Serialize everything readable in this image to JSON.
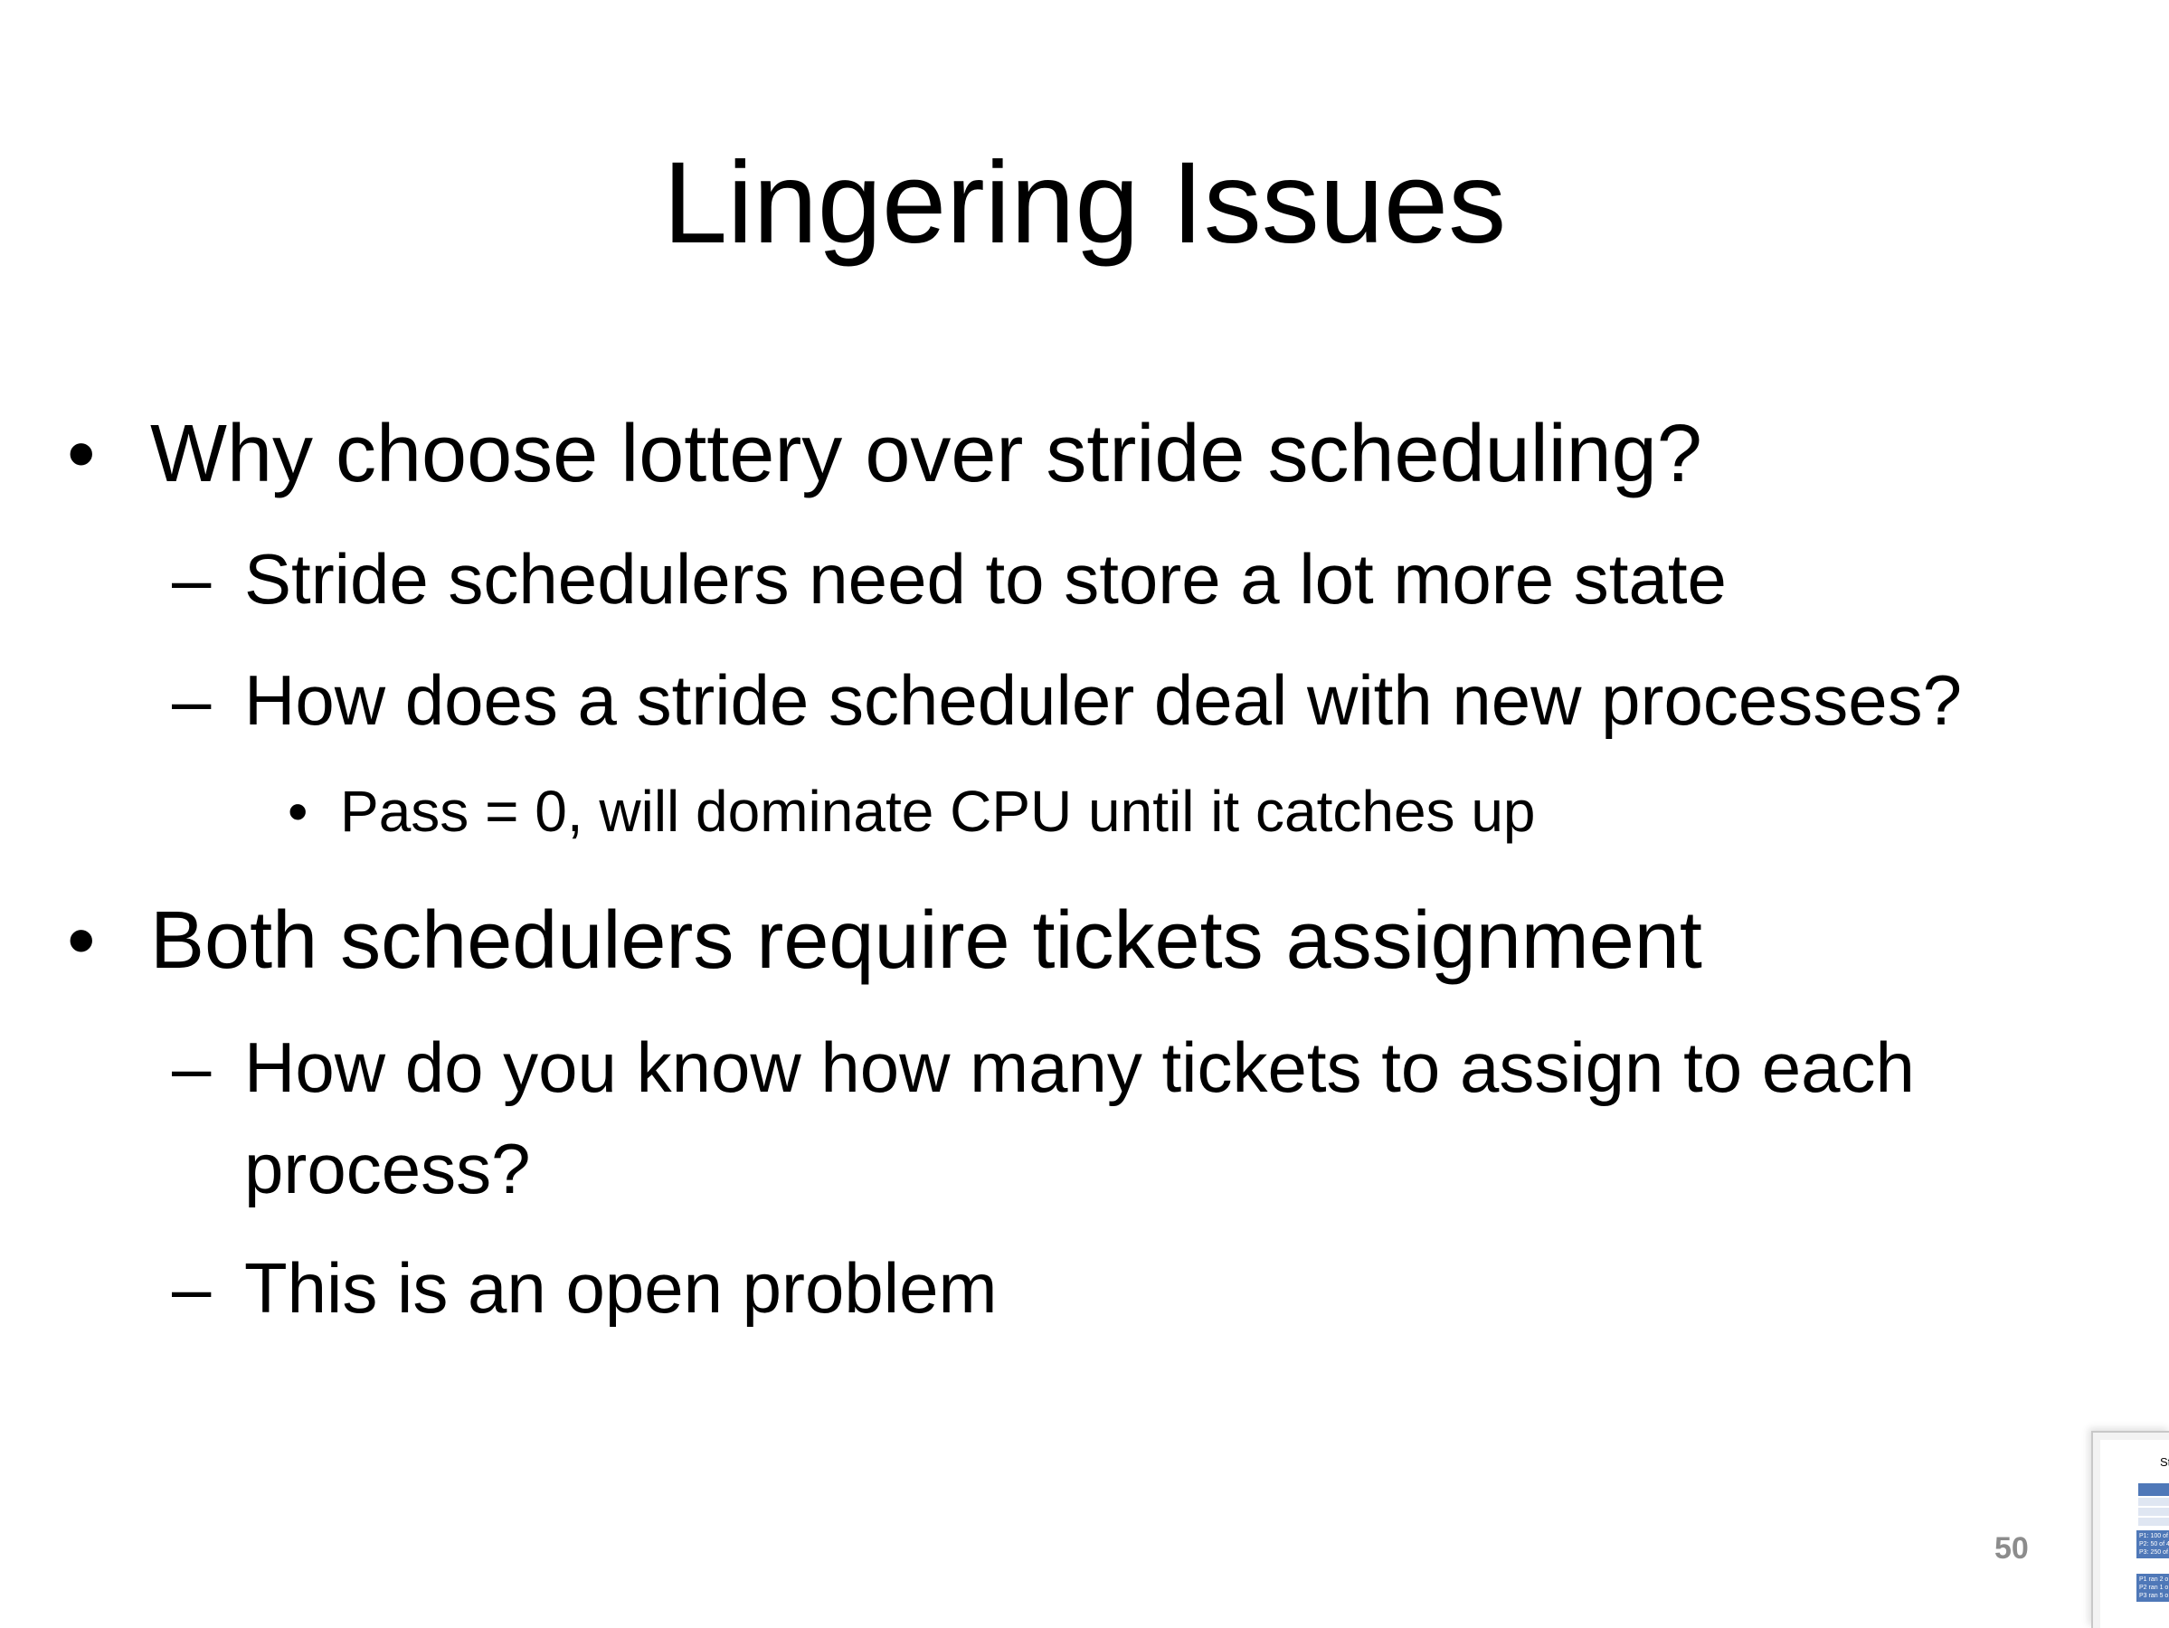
{
  "slide": {
    "title": "Lingering Issues",
    "bullet_glyph": "•",
    "dash_glyph": "–",
    "items": [
      {
        "level": 1,
        "text": "Why choose lottery over stride scheduling?"
      },
      {
        "level": 2,
        "text": "Stride schedulers need to store a lot more state"
      },
      {
        "level": 2,
        "text": "How does a stride scheduler deal with new processes?"
      },
      {
        "level": 3,
        "text": "Pass = 0, will dominate CPU until it catches up"
      },
      {
        "level": 1,
        "text": "Both schedulers require tickets assignment"
      },
      {
        "level": 2,
        "text": "How do you know how many tickets to assign to each",
        "continuation": "process?"
      },
      {
        "level": 2,
        "text": "This is an open problem"
      }
    ],
    "page_number": "50"
  },
  "thumbnail": {
    "title_fragment": "Str",
    "box1_lines": [
      "P1: 100 of 4",
      "P2: 50 of 40",
      "P3: 250 of 4"
    ],
    "box2_lines": [
      "P1 ran 2 o",
      "P2 ran 1 o",
      "P3 ran 5 o"
    ]
  },
  "colors": {
    "text": "#000000",
    "page_number": "#8c8c8c",
    "thumbnail_accent": "#4f78b8"
  }
}
